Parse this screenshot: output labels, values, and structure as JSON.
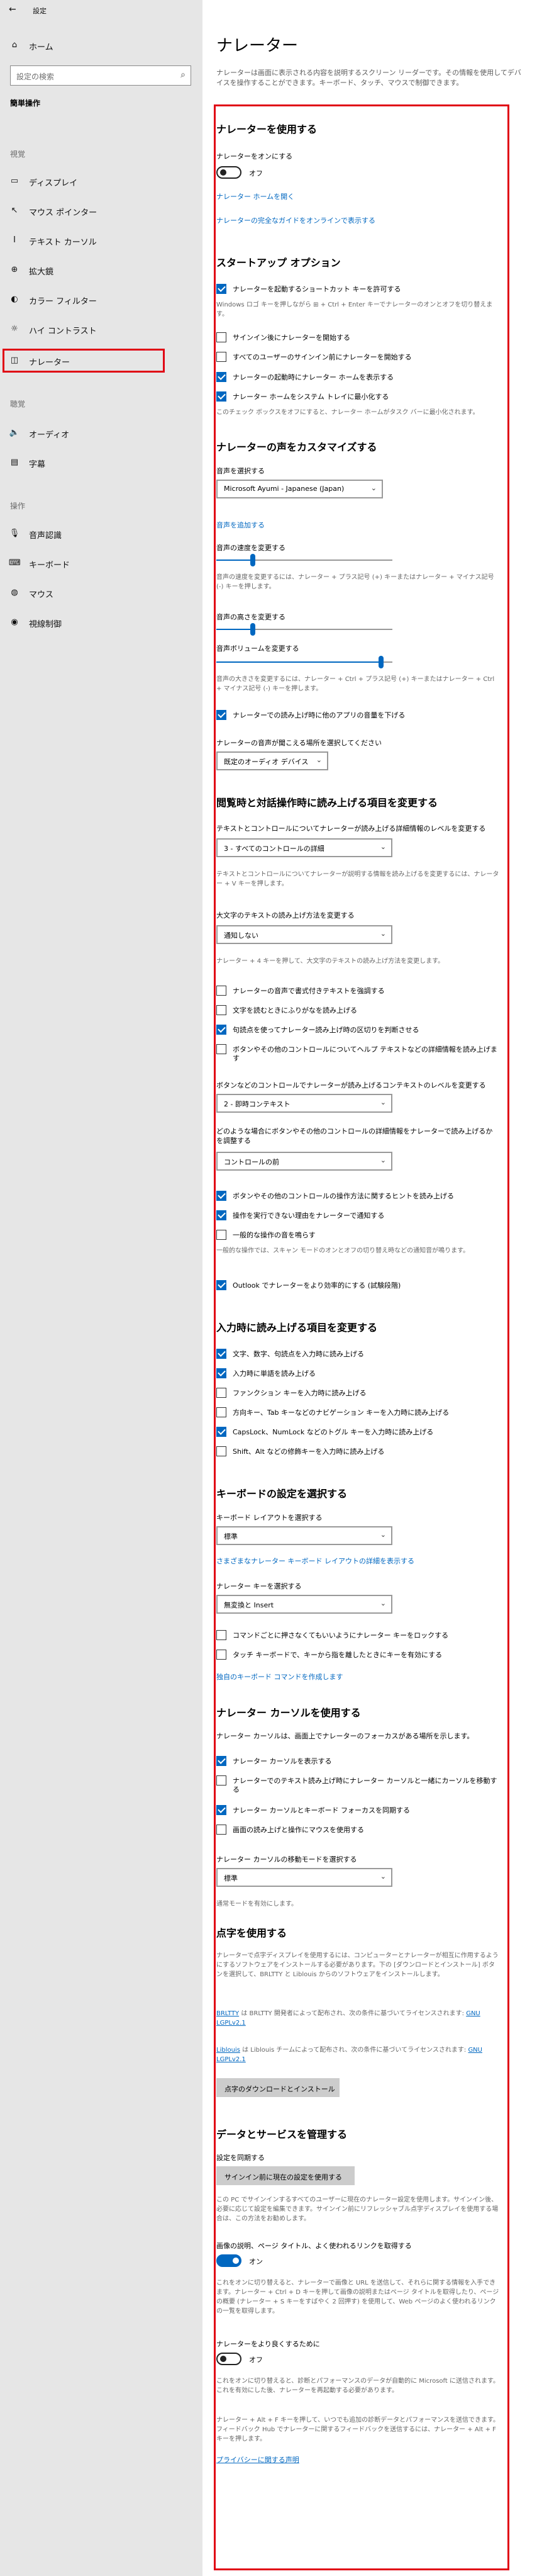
{
  "window": {
    "title": "設定",
    "back": "←"
  },
  "sidebar": {
    "home": "ホーム",
    "search_placeholder": "設定の検索",
    "category": "簡単操作",
    "section_vision": "視覚",
    "vision_items": [
      "ディスプレイ",
      "マウス ポインター",
      "テキスト カーソル",
      "拡大鏡",
      "カラー フィルター",
      "ハイ コントラスト",
      "ナレーター"
    ],
    "section_hearing": "聴覚",
    "hearing_items": [
      "オーディオ",
      "字幕"
    ],
    "section_interaction": "操作",
    "interaction_items": [
      "音声認識",
      "キーボード",
      "マウス",
      "視線制御"
    ]
  },
  "page": {
    "title": "ナレーター",
    "intro": "ナレーターは画面に表示される内容を説明するスクリーン リーダーです。その情報を使用してデバイスを操作することができます。キーボード、タッチ、マウスで制御できます。"
  },
  "use": {
    "heading": "ナレーターを使用する",
    "toggle_label": "ナレーターをオンにする",
    "toggle_state": "オフ",
    "home_link": "ナレーター ホームを開く",
    "guide_link": "ナレーターの完全なガイドをオンラインで表示する"
  },
  "startup": {
    "heading": "スタートアップ オプション",
    "shortcut": "ナレーターを起動するショートカット キーを許可する",
    "shortcut_help": "Windows ロゴ キーを押しながら ⊞ + Ctrl + Enter キーでナレーターのオンとオフを切り替えます。",
    "signin": "サインイン後にナレーターを開始する",
    "allusers": "すべてのユーザーのサインイン前にナレーターを開始する",
    "showhome": "ナレーターの起動時にナレーター ホームを表示する",
    "minimize": "ナレーター ホームをシステム トレイに最小化する",
    "minimize_help": "このチェック ボックスをオフにすると、ナレーター ホームがタスク バーに最小化されます。"
  },
  "voice": {
    "heading": "ナレーターの声をカスタマイズする",
    "choose_label": "音声を選択する",
    "voice_value": "Microsoft Ayumi - Japanese (Japan)",
    "add_link": "音声を追加する",
    "speed_label": "音声の速度を変更する",
    "speed_help": "音声の速度を変更するには、ナレーター + プラス記号 (+) キーまたはナレーター + マイナス記号 (-) キーを押します。",
    "pitch_label": "音声の高さを変更する",
    "volume_label": "音声ボリュームを変更する",
    "volume_help": "音声の大きさを変更するには、ナレーター + Ctrl + プラス記号 (+) キーまたはナレーター + Ctrl + マイナス記号 (-) キーを押します。",
    "lower_apps": "ナレーターでの読み上げ時に他のアプリの音量を下げる",
    "output_label": "ナレーターの音声が聞こえる場所を選択してください",
    "output_value": "既定のオーディオ デバイス",
    "speed_level": 0.2,
    "pitch_level": 0.2,
    "volume_level": 0.95
  },
  "reading": {
    "heading": "閲覧時と対話操作時に読み上げる項目を変更する",
    "detail_label": "テキストとコントロールについてナレーターが読み上げる詳細情報のレベルを変更する",
    "detail_value": "3 - すべてのコントロールの詳細",
    "detail_help": "テキストとコントロールについてナレーターが説明する情報を読み上げるを変更するには、ナレーター + V キーを押します。",
    "caps_label": "大文字のテキストの読み上げ方法を変更する",
    "caps_value": "通知しない",
    "caps_help": "ナレーター + 4 キーを押して、大文字のテキストの読み上げ方法を変更します。",
    "emphasize": "ナレーターの音声で書式付きテキストを強調する",
    "phonetic": "文字を読むときにふりがなを読み上げる",
    "pauses": "句読点を使ってナレーター読み上げ時の区切りを判断させる",
    "advanced": "ボタンやその他のコントロールについてヘルプ テキストなどの詳細情報を読み上げます",
    "context_label": "ボタンなどのコントロールでナレーターが読み上げるコンテキストのレベルを変更する",
    "context_value": "2 - 即時コンテキスト",
    "order_label": "どのような場合にボタンやその他のコントロールの詳細情報をナレーターで読み上げるかを調整する",
    "order_value": "コントロールの前",
    "hints": "ボタンやその他のコントロールの操作方法に関するヒントを読み上げる",
    "cannot": "操作を実行できない理由をナレーターで通知する",
    "audio_cues": "一般的な操作の音を鳴らす",
    "audio_help": "一般的な操作では、スキャン モードのオンとオフの切り替え時などの通知音が鳴ります。",
    "outlook": "Outlook でナレーターをより効率的にする (試験段階)"
  },
  "typing": {
    "heading": "入力時に読み上げる項目を変更する",
    "chars": "文字、数字、句読点を入力時に読み上げる",
    "words": "入力時に単語を読み上げる",
    "function": "ファンクション キーを入力時に読み上げる",
    "nav": "方向キー、Tab キーなどのナビゲーション キーを入力時に読み上げる",
    "toggle": "CapsLock、NumLock などのトグル キーを入力時に読み上げる",
    "modifier": "Shift、Alt などの修飾キーを入力時に読み上げる"
  },
  "keyboard": {
    "heading": "キーボードの設定を選択する",
    "layout_label": "キーボード レイアウトを選択する",
    "layout_value": "標準",
    "layout_link": "さまざまなナレーター キーボード レイアウトの詳細を表示する",
    "key_label": "ナレーター キーを選択する",
    "key_value": "無変換と Insert",
    "lock": "コマンドごとに押さなくてもいいようにナレーター キーをロックする",
    "touch": "タッチ キーボードで、キーから指を離したときにキーを有効にする",
    "custom_link": "独自のキーボード コマンドを作成します"
  },
  "cursor": {
    "heading": "ナレーター カーソルを使用する",
    "desc": "ナレーター カーソルは、画面上でナレーターのフォーカスがある場所を示します。",
    "show": "ナレーター カーソルを表示する",
    "move_text": "ナレーターでのテキスト読み上げ時にナレーター カーソルと一緒にカーソルを移動する",
    "sync": "ナレーター カーソルとキーボード フォーカスを同期する",
    "mouse": "画面の読み上げと操作にマウスを使用する",
    "mode_label": "ナレーター カーソルの移動モードを選択する",
    "mode_value": "標準",
    "mode_help": "通常モードを有効にします。"
  },
  "braille": {
    "heading": "点字を使用する",
    "desc": "ナレーターで点字ディスプレイを使用するには、コンピューターとナレーターが相互に作用するようにするソフトウェアをインストールする必要があります。下の [ダウンロードとインストール] ボタンを選択して、BRLTTY と Liblouis からのソフトウェアをインストールします。",
    "brltty_prefix": "BRLTTY",
    "brltty_text": " は BRLTTY 開発者によって配布され、次の条件に基づいてライセンスされます: ",
    "brltty_license": "GNU LGPLv2.1",
    "liblouis_prefix": "Liblouis",
    "liblouis_text": " は Liblouis チームによって配布され、次の条件に基づいてライセンスされます: ",
    "liblouis_license": "GNU LGPLv2.1",
    "button": "点字のダウンロードとインストール"
  },
  "data": {
    "heading": "データとサービスを管理する",
    "sync_label": "設定を同期する",
    "sync_button": "サインイン前に現在の設定を使用する",
    "sync_help": "この PC でサインインするすべてのユーザーに現在のナレーター設定を使用します。サインイン後、必要に応じて設定を編集できます。サインイン前にリフレッシャブル点字ディスプレイを使用する場合は、この方法をお勧めします。",
    "desc_label": "画像の説明、ページ タイトル、よく使われるリンクを取得する",
    "desc_state": "オン",
    "desc_help": "これをオンに切り替えると、ナレーターで画像と URL を送信して、それらに関する情報を入手できます。ナレーター + Ctrl + D キーを押して画像の説明またはページ タイトルを取得したり、ページの概要 (ナレーター + S キーをすばやく 2 回押す) を使用して、Web ページのよく使われるリンクの一覧を取得します。",
    "improve_label": "ナレーターをより良くするために",
    "improve_state": "オフ",
    "improve_help": "これをオンに切り替えると、診断とパフォーマンスのデータが自動的に Microsoft に送信されます。これを有効にした後、ナレーターを再起動する必要があります。",
    "feedback_help": "ナレーター + Alt + F キーを押して、いつでも追加の診断データとパフォーマンスを送信できます。フィードバック Hub でナレーターに関するフィードバックを送信するには、ナレーター + Alt + F キーを押します。",
    "privacy_link": "プライバシーに関する声明"
  }
}
